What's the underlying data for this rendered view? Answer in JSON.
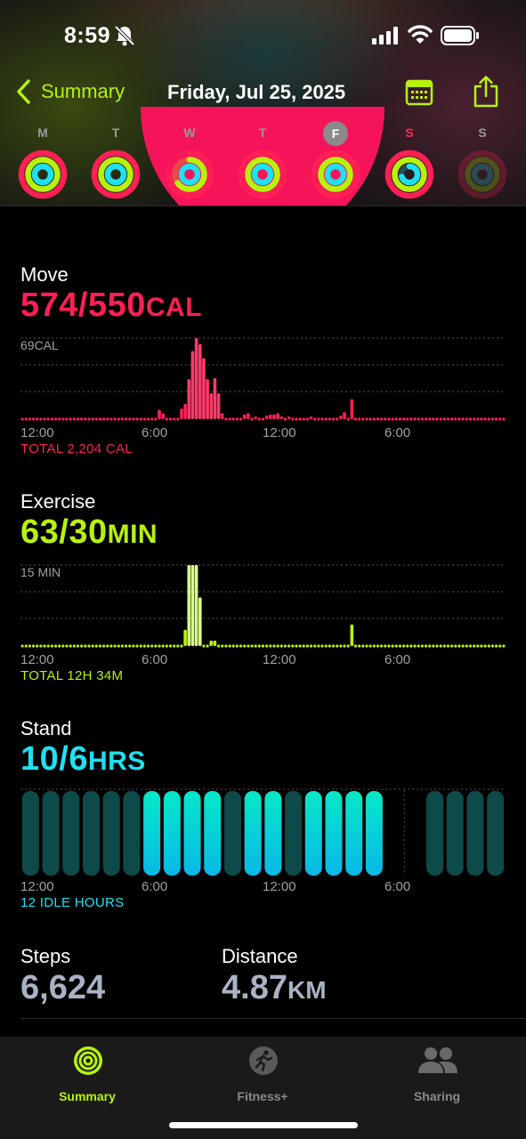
{
  "status_bar": {
    "time": "8:59",
    "icons": [
      "bell-slash-icon",
      "cellular-signal-icon",
      "wifi-icon",
      "battery-icon"
    ]
  },
  "nav": {
    "back_label": "Summary",
    "title": "Friday, Jul 25, 2025",
    "icons": [
      "chevron-left-icon",
      "calendar-icon",
      "share-icon"
    ]
  },
  "week": {
    "days": [
      {
        "letter": "M",
        "move": 1.0,
        "exercise": 1.0,
        "stand": 1.0
      },
      {
        "letter": "T",
        "move": 1.0,
        "exercise": 1.0,
        "stand": 1.0
      },
      {
        "letter": "W",
        "move": 0.75,
        "exercise": 0.65,
        "stand": 1.0
      },
      {
        "letter": "T",
        "move": 1.0,
        "exercise": 1.0,
        "stand": 1.0
      },
      {
        "letter": "F",
        "move": 1.0,
        "exercise": 1.0,
        "stand": 1.0
      },
      {
        "letter": "S",
        "move": 1.0,
        "exercise": 1.0,
        "stand": 0.7
      },
      {
        "letter": "S",
        "move": 0.0,
        "exercise": 0.0,
        "stand": 0.0
      }
    ],
    "selected_index": 4,
    "colors": {
      "move": "#ff1f55",
      "exercise": "#b7f20d",
      "stand": "#1fe0f0"
    }
  },
  "move": {
    "title": "Move",
    "value": "574/550",
    "unit": "CAL",
    "max_label": "69CAL",
    "total": "TOTAL 2,204 CAL",
    "x_labels": [
      "12:00",
      "6:00",
      "12:00",
      "6:00"
    ]
  },
  "exercise": {
    "title": "Exercise",
    "value": "63/30",
    "unit": "MIN",
    "max_label": "15 MIN",
    "total": "TOTAL 12H 34M",
    "x_labels": [
      "12:00",
      "6:00",
      "12:00",
      "6:00"
    ]
  },
  "stand": {
    "title": "Stand",
    "value": "10/6",
    "unit": "HRS",
    "idle": "12 IDLE HOURS",
    "x_labels": [
      "12:00",
      "6:00",
      "12:00",
      "6:00"
    ]
  },
  "metrics": {
    "steps_label": "Steps",
    "steps_value": "6,624",
    "distance_label": "Distance",
    "distance_value": "4.87",
    "distance_unit": "KM"
  },
  "tabs": [
    {
      "label": "Summary",
      "icon": "activity-rings-icon",
      "active": true
    },
    {
      "label": "Fitness+",
      "icon": "fitness-plus-icon",
      "active": false
    },
    {
      "label": "Sharing",
      "icon": "sharing-people-icon",
      "active": false
    }
  ],
  "chart_data": [
    {
      "type": "bar",
      "title": "Move",
      "ylabel": "CAL",
      "ylim": [
        0,
        69
      ],
      "x_tick_labels": [
        "12:00",
        "6:00",
        "12:00",
        "6:00"
      ],
      "bins_per_hour": 4,
      "values": [
        0,
        0,
        0,
        0,
        0,
        0,
        0,
        0,
        0,
        0,
        0,
        0,
        0,
        0,
        0,
        0,
        0,
        0,
        0,
        0,
        0,
        0,
        0,
        0,
        0,
        0,
        0,
        0,
        0,
        0,
        0,
        0,
        0,
        0,
        0,
        0,
        0,
        8,
        5,
        0,
        0,
        0,
        0,
        9,
        13,
        34,
        58,
        69,
        64,
        52,
        34,
        22,
        35,
        22,
        5,
        0,
        0,
        0,
        0,
        0,
        4,
        5,
        0,
        2,
        0,
        0,
        3,
        4,
        4,
        5,
        2,
        0,
        2,
        0,
        0,
        0,
        0,
        0,
        2,
        0,
        0,
        0,
        0,
        0,
        0,
        0,
        3,
        6,
        0,
        17,
        0,
        0,
        0,
        0,
        0,
        0,
        0,
        0,
        0,
        0,
        0,
        0,
        0,
        0,
        0,
        0,
        0,
        0,
        0,
        0,
        0,
        0,
        0,
        0,
        0,
        0,
        0,
        0,
        0,
        0,
        0,
        0,
        0,
        0,
        0,
        0,
        0,
        0,
        0,
        0,
        0
      ],
      "color": "#ff1f55"
    },
    {
      "type": "bar",
      "title": "Exercise",
      "ylabel": "MIN",
      "ylim": [
        0,
        15
      ],
      "x_tick_labels": [
        "12:00",
        "6:00",
        "12:00",
        "6:00"
      ],
      "bins_per_hour": 4,
      "values": [
        0,
        0,
        0,
        0,
        0,
        0,
        0,
        0,
        0,
        0,
        0,
        0,
        0,
        0,
        0,
        0,
        0,
        0,
        0,
        0,
        0,
        0,
        0,
        0,
        0,
        0,
        0,
        0,
        0,
        0,
        0,
        0,
        0,
        0,
        0,
        0,
        0,
        0,
        0,
        0,
        0,
        0,
        0,
        0,
        3,
        15,
        15,
        15,
        9,
        0,
        0,
        1,
        1,
        0,
        0,
        0,
        0,
        0,
        0,
        0,
        0,
        0,
        0,
        0,
        0,
        0,
        0,
        0,
        0,
        0,
        0,
        0,
        0,
        0,
        0,
        0,
        0,
        0,
        0,
        0,
        0,
        0,
        0,
        0,
        0,
        0,
        0,
        0,
        0,
        4,
        0,
        0,
        0,
        0,
        0,
        0,
        0,
        0,
        0,
        0,
        0,
        0,
        0,
        0,
        0,
        0,
        0,
        0,
        0,
        0,
        0,
        0,
        0,
        0,
        0,
        0,
        0,
        0,
        0,
        0,
        0,
        0,
        0,
        0,
        0,
        0,
        0,
        0,
        0,
        0,
        0
      ],
      "color": "#b7f20d"
    },
    {
      "type": "bar",
      "title": "Stand",
      "x_tick_labels": [
        "12:00",
        "6:00",
        "12:00",
        "6:00"
      ],
      "hours": 24,
      "stood": [
        false,
        false,
        false,
        false,
        false,
        false,
        true,
        true,
        true,
        true,
        false,
        true,
        true,
        false,
        true,
        true,
        true,
        true,
        null,
        null,
        false,
        false,
        false,
        false
      ],
      "color_stood": "#1fe0f0",
      "color_idle": "#0e4a4a"
    }
  ]
}
